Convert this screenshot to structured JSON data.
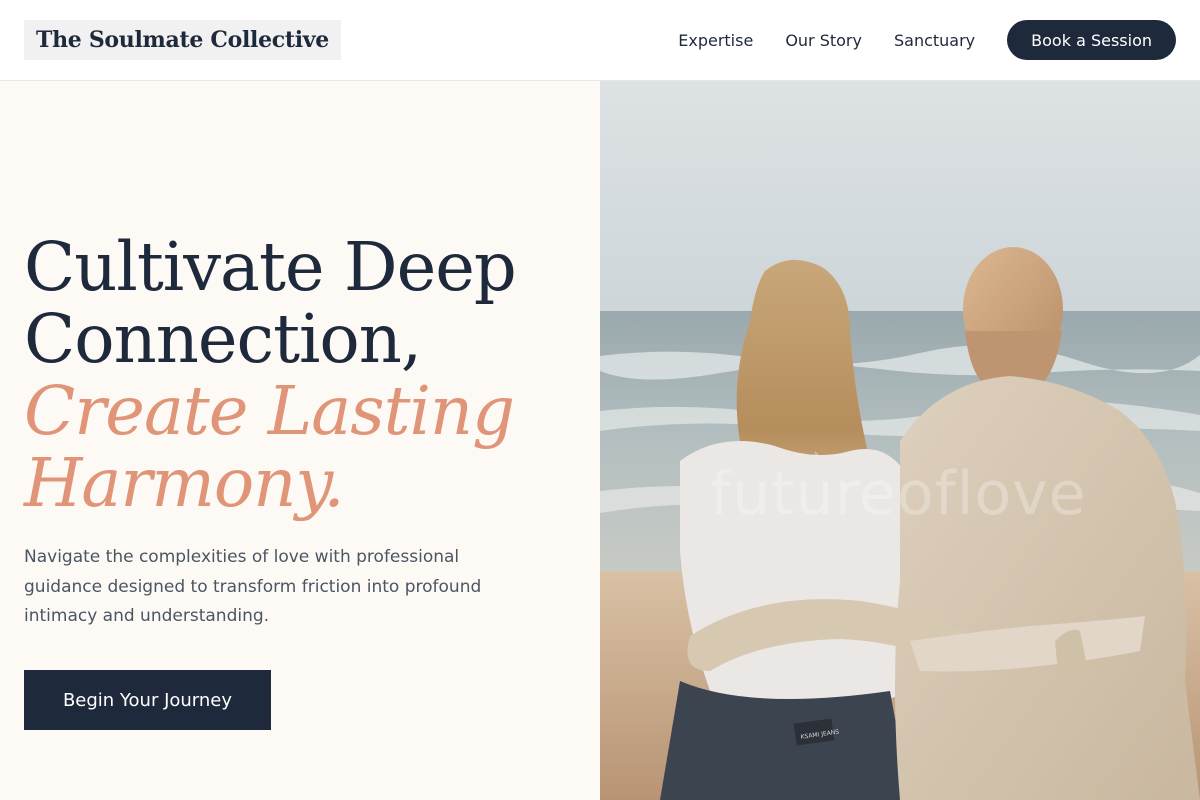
{
  "header": {
    "logo": "The Soulmate Collective",
    "nav": [
      "Expertise",
      "Our Story",
      "Sanctuary"
    ],
    "cta": "Book a Session"
  },
  "hero": {
    "headline_line1": "Cultivate Deep",
    "headline_line2": "Connection,",
    "accent_line1": "Create Lasting",
    "accent_line2": "Harmony.",
    "description": "Navigate the complexities of love with professional guidance designed to transform friction into profound intimacy and understanding.",
    "cta": "Begin Your Journey"
  },
  "image": {
    "watermark": "futureoflove",
    "denim_label": "KSAMI JEANS"
  },
  "colors": {
    "navy": "#1e293b",
    "accent": "#e09478",
    "cream": "#fdfaf6",
    "body_text": "#4b5563"
  }
}
